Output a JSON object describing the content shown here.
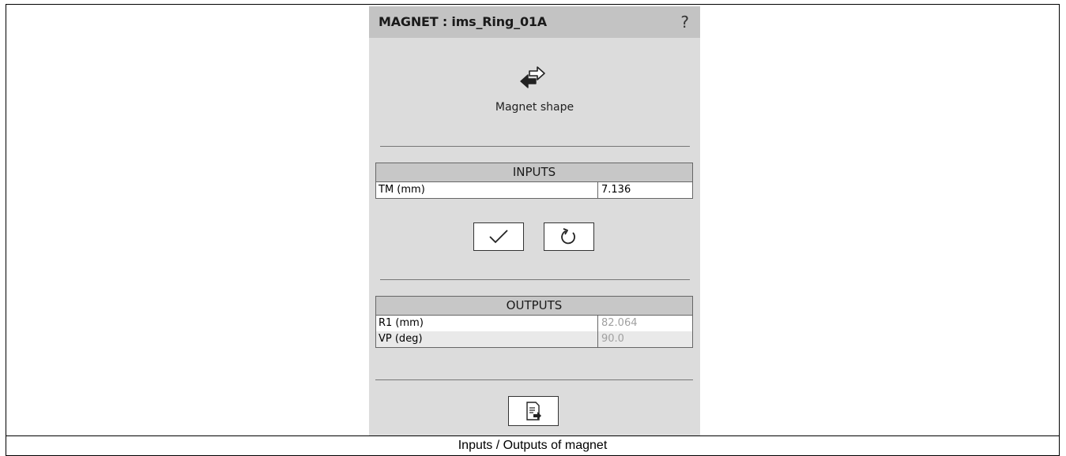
{
  "panel": {
    "title": "MAGNET : ims_Ring_01A",
    "help_label": "?",
    "shape_label": "Magnet shape"
  },
  "inputs": {
    "header": "INPUTS",
    "rows": [
      {
        "label": "TM (mm)",
        "value": "7.136"
      }
    ]
  },
  "outputs": {
    "header": "OUTPUTS",
    "rows": [
      {
        "label": "R1 (mm)",
        "value": "82.064"
      },
      {
        "label": "VP (deg)",
        "value": "90.0"
      }
    ]
  },
  "icons": {
    "shape": "swap-arrows-icon",
    "apply": "checkmark-icon",
    "reset": "undo-icon",
    "export": "document-export-icon"
  },
  "caption": "Inputs / Outputs of magnet"
}
